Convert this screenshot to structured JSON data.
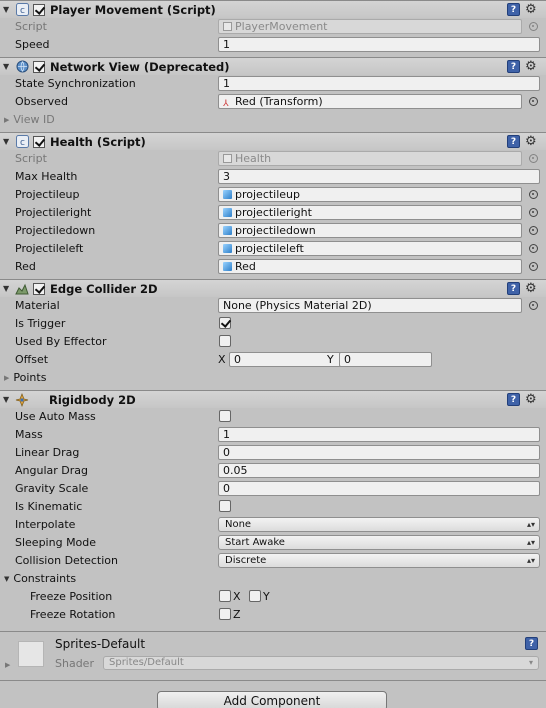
{
  "player_movement": {
    "title": "Player Movement (Script)",
    "script_label": "Script",
    "script_value": "PlayerMovement",
    "speed_label": "Speed",
    "speed_value": "1"
  },
  "network_view": {
    "title": "Network View (Deprecated)",
    "state_sync_label": "State Synchronization",
    "state_sync_value": "1",
    "observed_label": "Observed",
    "observed_value": "Red (Transform)",
    "view_id_label": "View ID"
  },
  "health": {
    "title": "Health (Script)",
    "script_label": "Script",
    "script_value": "Health",
    "max_health_label": "Max Health",
    "max_health_value": "3",
    "projectileup_label": "Projectileup",
    "projectileup_value": "projectileup",
    "projectileright_label": "Projectileright",
    "projectileright_value": "projectileright",
    "projectiledown_label": "Projectiledown",
    "projectiledown_value": "projectiledown",
    "projectileleft_label": "Projectileleft",
    "projectileleft_value": "projectileleft",
    "red_label": "Red",
    "red_value": "Red"
  },
  "edge_collider": {
    "title": "Edge Collider 2D",
    "material_label": "Material",
    "material_value": "None (Physics Material 2D)",
    "is_trigger_label": "Is Trigger",
    "is_trigger": true,
    "used_by_effector_label": "Used By Effector",
    "used_by_effector": false,
    "offset_label": "Offset",
    "offset_x_label": "X",
    "offset_x": "0",
    "offset_y_label": "Y",
    "offset_y": "0",
    "points_label": "Points"
  },
  "rigidbody": {
    "title": "Rigidbody 2D",
    "use_auto_mass_label": "Use Auto Mass",
    "use_auto_mass": false,
    "mass_label": "Mass",
    "mass_value": "1",
    "linear_drag_label": "Linear Drag",
    "linear_drag_value": "0",
    "angular_drag_label": "Angular Drag",
    "angular_drag_value": "0.05",
    "gravity_scale_label": "Gravity Scale",
    "gravity_scale_value": "0",
    "is_kinematic_label": "Is Kinematic",
    "is_kinematic": false,
    "interpolate_label": "Interpolate",
    "interpolate_value": "None",
    "sleeping_mode_label": "Sleeping Mode",
    "sleeping_mode_value": "Start Awake",
    "collision_detection_label": "Collision Detection",
    "collision_detection_value": "Discrete",
    "constraints_label": "Constraints",
    "freeze_position_label": "Freeze Position",
    "freeze_position_x_label": "X",
    "freeze_position_y_label": "Y",
    "freeze_rotation_label": "Freeze Rotation",
    "freeze_rotation_z_label": "Z"
  },
  "material": {
    "name": "Sprites-Default",
    "shader_label": "Shader",
    "shader_value": "Sprites/Default"
  },
  "add_component_label": "Add Component",
  "colors": {
    "panel_bg": "#c2c2c2",
    "help_icon": "#3f62a8"
  }
}
